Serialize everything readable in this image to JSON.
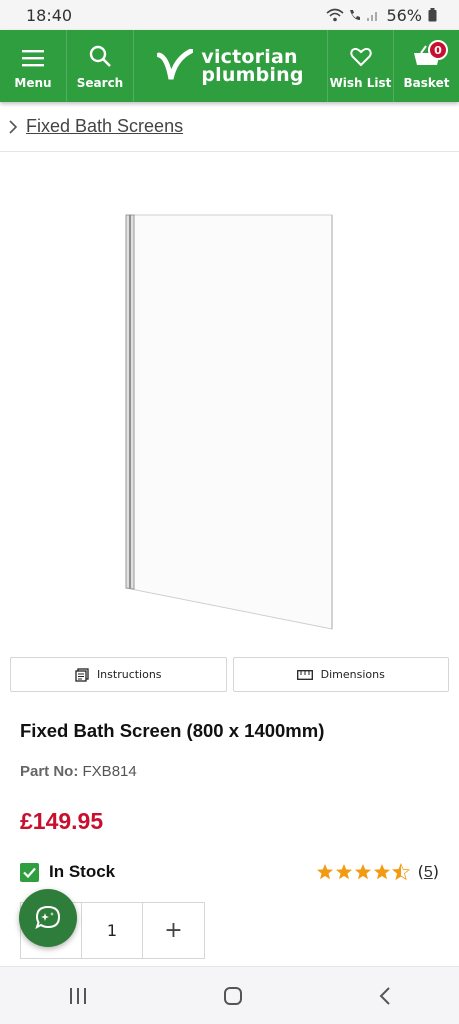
{
  "status_bar": {
    "time": "18:40",
    "battery": "56%"
  },
  "header": {
    "menu_label": "Menu",
    "search_label": "Search",
    "logo_line1": "victorian",
    "logo_line2": "plumbing",
    "wishlist_label": "Wish List",
    "basket_label": "Basket",
    "basket_count": "0",
    "brand_color": "#2e9e3e"
  },
  "breadcrumb": {
    "label": "Fixed Bath Screens"
  },
  "doc_buttons": {
    "instructions": "Instructions",
    "dimensions": "Dimensions"
  },
  "product": {
    "title": "Fixed Bath Screen (800 x 1400mm)",
    "part_no_label": "Part No:",
    "part_no": "FXB814",
    "price": "£149.95",
    "price_color": "#c8102e",
    "stock": "In Stock",
    "rating": 4.5,
    "rating_max": 5,
    "review_count": "5",
    "quantity": "1",
    "increment_label": "+"
  },
  "icons": [
    "menu-icon",
    "search-icon",
    "heart-icon",
    "basket-icon",
    "chevron-right-icon",
    "document-icon",
    "ruler-icon",
    "check-icon",
    "chat-icon",
    "recents-icon",
    "home-icon",
    "back-icon"
  ]
}
